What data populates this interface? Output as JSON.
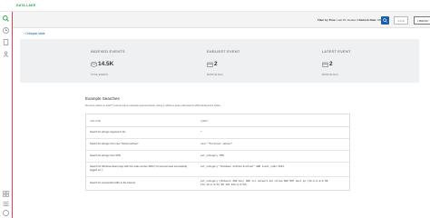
{
  "app": {
    "title": "DATA LAKE"
  },
  "filter": {
    "text_prefix": "Filter by Time:",
    "time_value": "Last 15 minutes",
    "refresh_label": "Refresh Rate:",
    "refresh_value": "Off"
  },
  "toolbar": {
    "save_label": "SAVE",
    "library_label": "LIBRARY"
  },
  "collapse_label": "Collapse stats",
  "stats": [
    {
      "title": "INDEXED EVENTS",
      "value": "14.5K",
      "sub": "TOTAL EVENTS",
      "icon": "database-icon"
    },
    {
      "title": "EARLIEST EVENT",
      "value": "2",
      "sub": "MONTHS AGO",
      "icon": "calendar-icon"
    },
    {
      "title": "LATEST EVENT",
      "value": "2",
      "sub": "MONTHS AGO",
      "icon": "calendar-icon"
    }
  ],
  "examples": {
    "title": "Example Searches",
    "description": "Not sure where to start? Look at some example queries below. Using 1 within a query will search within Endpoint's Index.",
    "columns": [
      "USE CASE",
      "QUERY"
    ],
    "rows": [
      {
        "use_case": "Search for all logs ingested in DL",
        "query": "*"
      },
      {
        "use_case": "Search for all logs from user \"fortinet.sebsec\"",
        "query": "user:\"fortinet.sebsec\""
      },
      {
        "use_case": "Search for all logs from VPN",
        "query": "evt_category:VPN"
      },
      {
        "use_case": "Search for Windows Event logs with the code number 4624 (\"An account was successfully logged on.\")",
        "query": "evt_category:\"Windows Authentication\" AND event_code:4624"
      },
      {
        "use_case": "Search for successful traffic to the Internet",
        "query": "evt_category:(Network AND Ids) AND src.network.dir:allow AND NOT dest.ip:(10.0.0.0/8 OR 172.16.0.0/12 OR 192.168.0.0/16)"
      }
    ]
  },
  "colors": {
    "accent": "#25a244",
    "primary": "#1a5fa8",
    "danger_line": "#e0434c"
  }
}
